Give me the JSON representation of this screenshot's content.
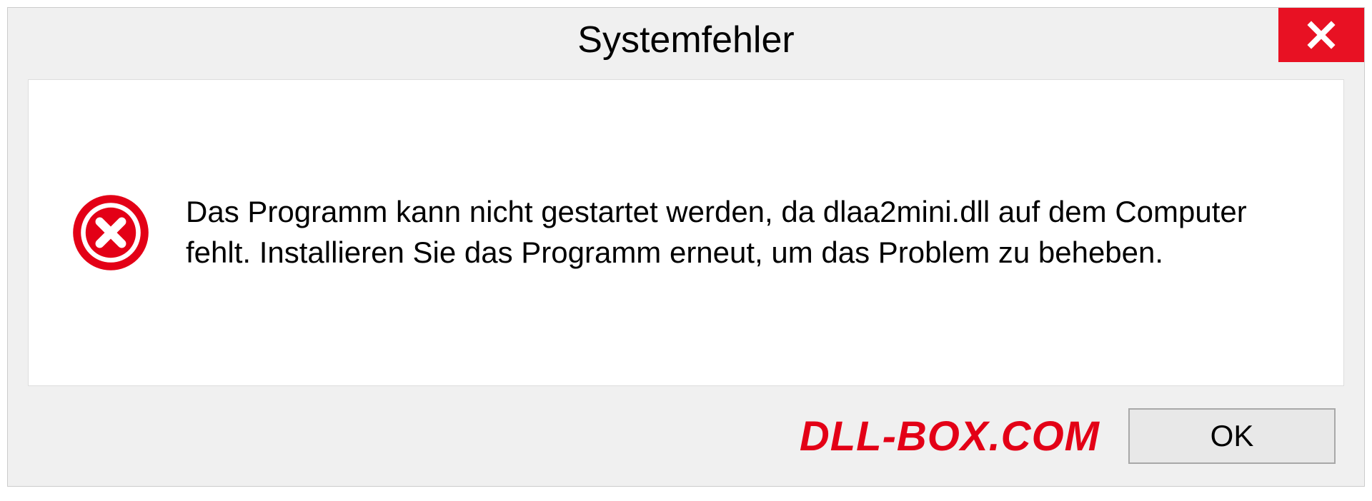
{
  "dialog": {
    "title": "Systemfehler",
    "message": "Das Programm kann nicht gestartet werden, da dlaa2mini.dll auf dem Computer fehlt. Installieren Sie das Programm erneut, um das Problem zu beheben.",
    "ok_label": "OK"
  },
  "watermark": "DLL-BOX.COM",
  "colors": {
    "close_bg": "#e81123",
    "error_icon": "#e30016",
    "watermark": "#e30016"
  }
}
